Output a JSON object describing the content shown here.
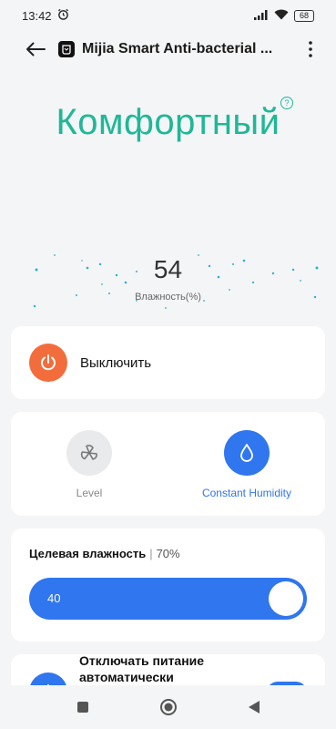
{
  "status_bar": {
    "time": "13:42",
    "battery": "68"
  },
  "header": {
    "title": "Mijia Smart Anti-bacterial ..."
  },
  "hero": {
    "mode_title": "Комфортный",
    "help": "?",
    "humidity": "54",
    "humidity_label": "Влажность(%)"
  },
  "power": {
    "label": "Выключить"
  },
  "modes": [
    {
      "label": "Level",
      "active": false,
      "icon": "fan-icon"
    },
    {
      "label": "Constant Humidity",
      "active": true,
      "icon": "water-drop-icon"
    }
  ],
  "target": {
    "title": "Целевая влажность",
    "separator": "|",
    "value": "70%",
    "slider_value": "40",
    "slider_fraction": 1.0
  },
  "auto_off": {
    "label": "Отключать питание автоматически",
    "enabled": true
  },
  "colors": {
    "accent": "#2f76ef",
    "mode_green": "#1fb896",
    "power_orange": "#f26d3b"
  }
}
